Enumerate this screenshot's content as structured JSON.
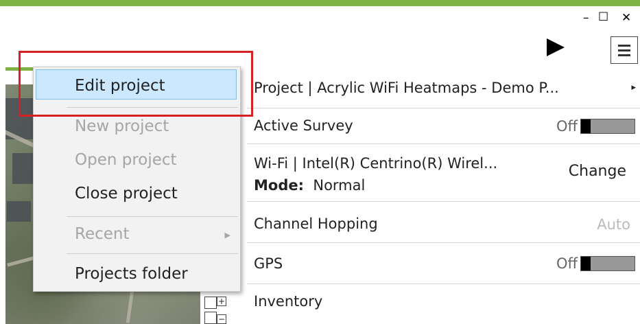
{
  "window": {
    "minimize_glyph": "–",
    "maximize_glyph": "☐",
    "close_glyph": "✕"
  },
  "toolbar": {
    "play_icon": "play-icon",
    "menu_icon": "hamburger-menu-icon"
  },
  "panel": {
    "project_label": "Project  |  Acrylic WiFi Heatmaps - Demo P...",
    "project_arrow": "▸",
    "active_survey_label": "Active Survey",
    "active_survey_state": "Off",
    "wifi_label": "Wi-Fi | Intel(R) Centrino(R) Wirel...",
    "mode_key": "Mode:",
    "mode_value": "Normal",
    "change_label": "Change",
    "channel_hopping_label": "Channel Hopping",
    "channel_hopping_value": "Auto",
    "gps_label": "GPS",
    "gps_state": "Off",
    "inventory_label": "Inventory"
  },
  "context_menu": {
    "items": [
      {
        "label": "Edit project",
        "enabled": true,
        "selected": true
      },
      {
        "label": "New project",
        "enabled": false
      },
      {
        "label": "Open project",
        "enabled": false
      },
      {
        "label": "Close project",
        "enabled": true
      },
      {
        "label": "Recent",
        "enabled": false,
        "has_submenu": true
      },
      {
        "label": "Projects folder",
        "enabled": true
      }
    ],
    "submenu_arrow": "▶"
  },
  "map": {
    "zoom_in": "+",
    "zoom_out": "−"
  },
  "colors": {
    "accent_green": "#7cb342",
    "highlight_red": "#d62023",
    "menu_selection": "#cce8ff"
  }
}
